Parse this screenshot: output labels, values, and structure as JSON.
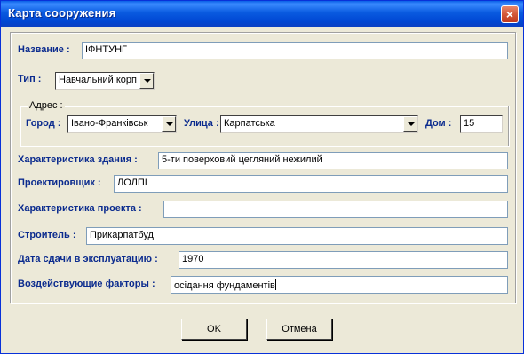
{
  "window": {
    "title": "Карта сооружения",
    "close_glyph": "×"
  },
  "form": {
    "name": {
      "label": "Название :",
      "value": "ІФНТУНГ"
    },
    "type": {
      "label": "Тип :",
      "value": "Навчальний корп"
    },
    "address": {
      "legend": "Адрес :",
      "city": {
        "label": "Город :",
        "value": "Івано-Франківськ"
      },
      "street": {
        "label": "Улица :",
        "value": "Карпатська"
      },
      "house": {
        "label": "Дом :",
        "value": "15"
      }
    },
    "building_char": {
      "label": "Характеристика здания :",
      "value": "5-ти поверховий цегляний нежилий"
    },
    "designer": {
      "label": "Проектировщик :",
      "value": "ЛОЛПІ"
    },
    "project_char": {
      "label": "Характеристика проекта :",
      "value": ""
    },
    "builder": {
      "label": "Строитель :",
      "value": "Прикарпатбуд"
    },
    "commission_date": {
      "label": "Дата сдачи в эксплуатацию :",
      "value": "1970"
    },
    "factors": {
      "label": "Воздействующие факторы :",
      "value": "осідання фундаментів"
    }
  },
  "buttons": {
    "ok": "OK",
    "cancel": "Отмена"
  },
  "colors": {
    "titlebar": "#0a5be0",
    "label_text": "#0b2b8e",
    "face": "#ece9d8",
    "close": "#d45a3a"
  }
}
